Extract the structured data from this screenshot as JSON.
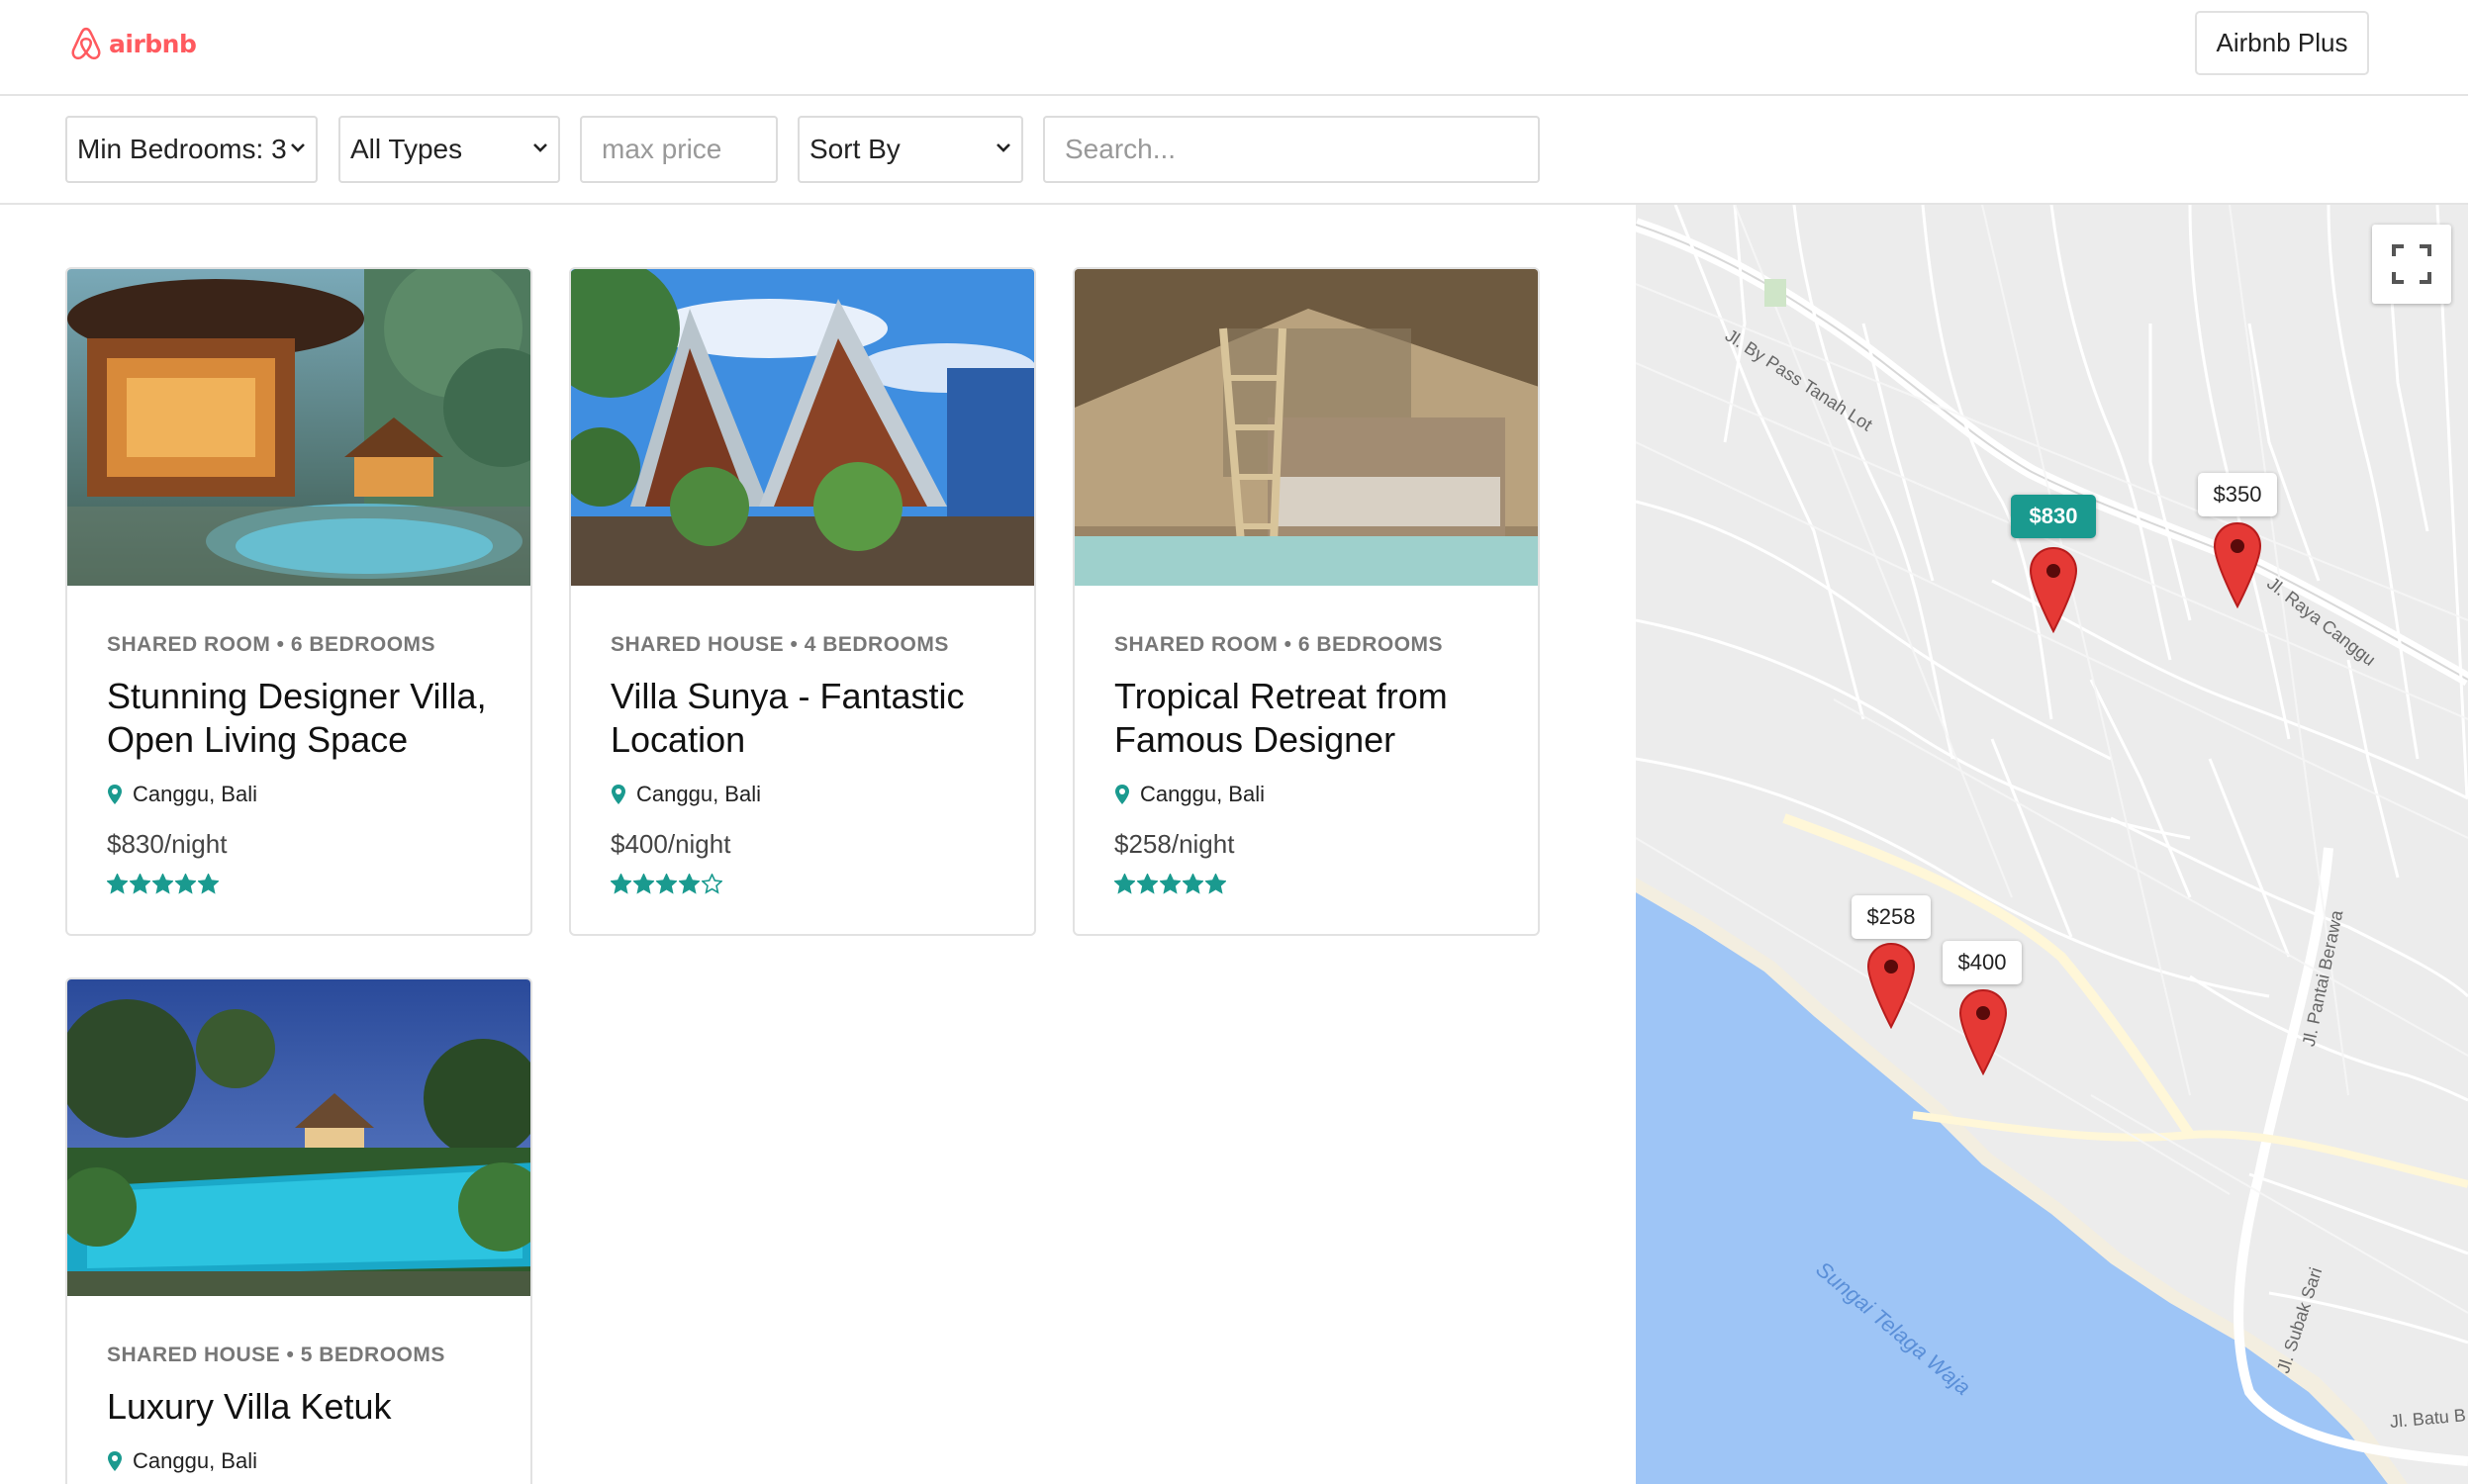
{
  "header": {
    "logo_text": "airbnb",
    "plus_button_label": "Airbnb Plus"
  },
  "filters": {
    "min_bedrooms": "Min Bedrooms: 3",
    "type": "All Types",
    "max_price_placeholder": "max price",
    "sort_by": "Sort By",
    "search_placeholder": "Search..."
  },
  "listings": [
    {
      "meta": "SHARED ROOM • 6 BEDROOMS",
      "title": "Stunning Designer Villa, Open Living Space",
      "location": "Canggu, Bali",
      "price": "$830/night",
      "rating": 5
    },
    {
      "meta": "SHARED HOUSE • 4 BEDROOMS",
      "title": "Villa Sunya - Fantastic Location",
      "location": "Canggu, Bali",
      "price": "$400/night",
      "rating": 4
    },
    {
      "meta": "SHARED ROOM • 6 BEDROOMS",
      "title": "Tropical Retreat from Famous Designer",
      "location": "Canggu, Bali",
      "price": "$258/night",
      "rating": 5
    },
    {
      "meta": "SHARED HOUSE • 5 BEDROOMS",
      "title": "Luxury Villa Ketuk",
      "location": "Canggu, Bali",
      "price": "",
      "rating": 0
    }
  ],
  "map": {
    "markers": [
      {
        "label": "$830",
        "active": true
      },
      {
        "label": "$350",
        "active": false
      },
      {
        "label": "$258",
        "active": false
      },
      {
        "label": "$400",
        "active": false
      }
    ],
    "streets": [
      "Jl. By Pass Tanah Lot",
      "Jl. Raya Canggu",
      "Jl. Pantai Berawa",
      "Jl. Subak Sari",
      "Jl. Batu B",
      "Sungai Telaga Waja"
    ]
  },
  "colors": {
    "brand": "#ff5a5f",
    "accent": "#1a9a8f",
    "pin": "#e53935",
    "water": "#9ec5f6"
  }
}
